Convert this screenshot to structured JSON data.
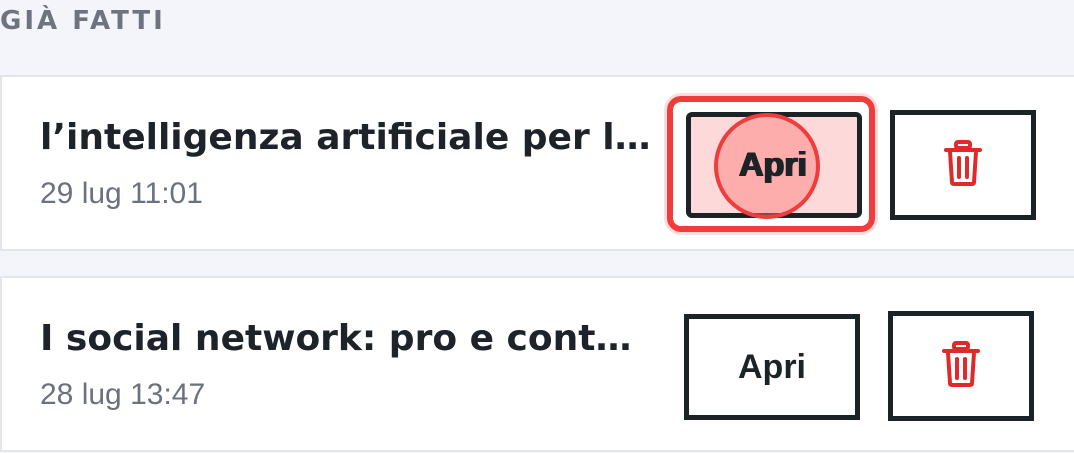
{
  "section": {
    "title": "GIÀ FATTI"
  },
  "items": [
    {
      "title": "l’intelligenza artificiale per l…",
      "date": "29 lug 11:01",
      "open_label": "Apri",
      "delete_icon": "trash-icon"
    },
    {
      "title": "I social network: pro e cont…",
      "date": "28 lug 13:47",
      "open_label": "Apri",
      "delete_icon": "trash-icon"
    }
  ],
  "colors": {
    "background": "#f4f5fb",
    "card": "#ffffff",
    "text": "#1d2328",
    "muted": "#6c7180",
    "danger": "#e02a2a",
    "highlight": "#f23b3b"
  }
}
